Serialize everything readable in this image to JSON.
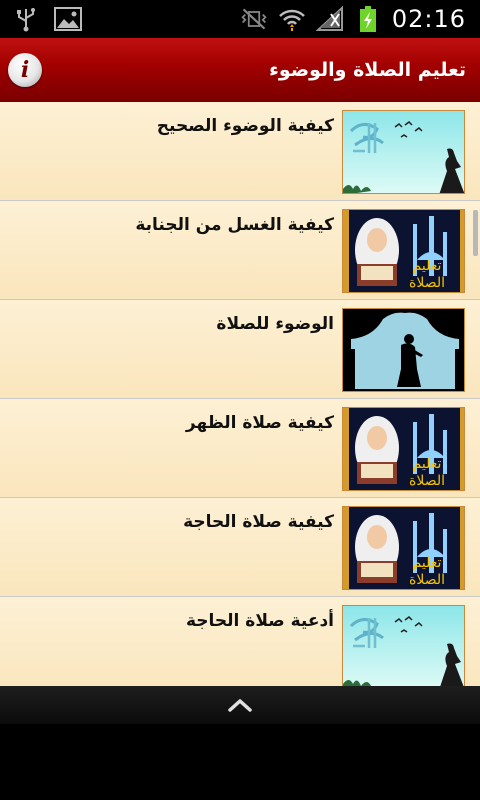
{
  "status_bar": {
    "time": "02:16",
    "left_icons": [
      "usb-icon",
      "image-notification-icon"
    ],
    "right_icons": [
      "vibrate-mute-icon",
      "wifi-icon",
      "signal-icon",
      "battery-charging-icon"
    ]
  },
  "app_bar": {
    "title": "تعليم الصلاة والوضوء",
    "info_glyph": "i",
    "accent": "#a00000"
  },
  "list": {
    "items": [
      {
        "title": "كيفية الوضوء الصحيح",
        "thumb": "allah-calligraphy-dervish"
      },
      {
        "title": "كيفية الغسل من الجنابة",
        "thumb": "girl-quran-mosque"
      },
      {
        "title": "الوضوء للصلاة",
        "thumb": "praying-silhouette-mosque"
      },
      {
        "title": "كيفية صلاة الظهر",
        "thumb": "girl-quran-mosque"
      },
      {
        "title": "كيفية صلاة الحاجة",
        "thumb": "girl-quran-mosque"
      },
      {
        "title": "أدعية صلاة الحاجة",
        "thumb": "allah-calligraphy-dervish"
      }
    ],
    "thumb_overlay_text": [
      "تعليم",
      "الصلاة"
    ]
  },
  "bottom_bar": {
    "icon": "chevron-up-icon"
  }
}
